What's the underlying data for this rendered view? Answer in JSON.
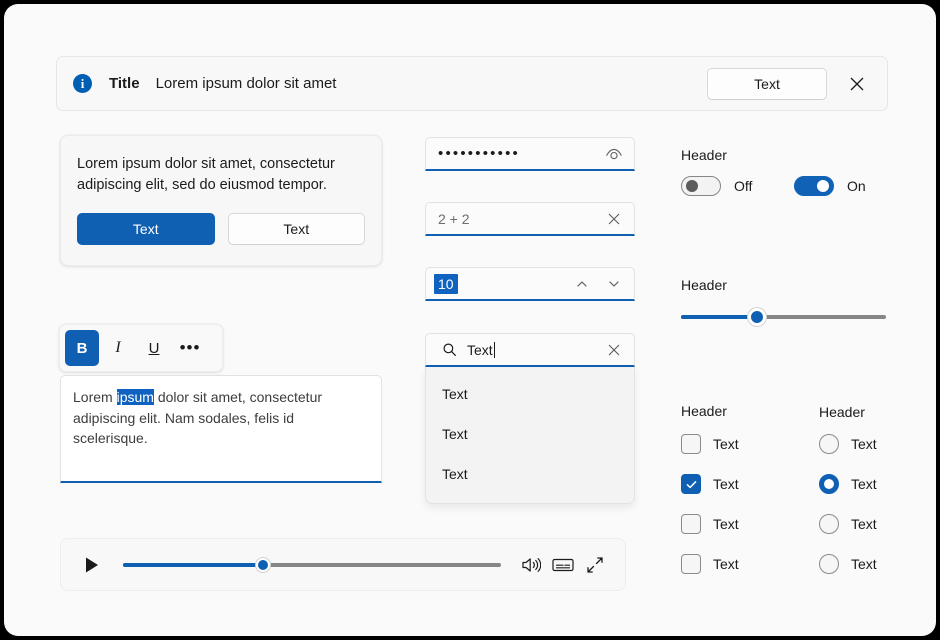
{
  "infobar": {
    "icon": "info-icon",
    "title": "Title",
    "message": "Lorem ipsum dolor sit amet",
    "action_label": "Text",
    "close_icon": "close-icon"
  },
  "dialog": {
    "body": "Lorem ipsum dolor sit amet, consectetur adipiscing elit, sed do eiusmod tempor.",
    "primary_label": "Text",
    "secondary_label": "Text"
  },
  "editor": {
    "toolbar": [
      {
        "name": "bold",
        "glyph": "B",
        "active": true
      },
      {
        "name": "italic",
        "glyph": "I",
        "active": false
      },
      {
        "name": "underline",
        "glyph": "U",
        "active": false
      },
      {
        "name": "more",
        "glyph": "•••",
        "active": false
      }
    ],
    "text_before": "Lorem ",
    "text_selected": "ipsum",
    "text_after": " dolor sit amet, consectetur adipiscing elit. Nam sodales, felis id scelerisque."
  },
  "media": {
    "play_icon": "play-icon",
    "progress_percent": 37,
    "volume_icon": "volume-icon",
    "captions_icon": "captions-icon",
    "fullscreen_icon": "fullscreen-icon"
  },
  "fields": {
    "password": {
      "value": "•••••••••••",
      "reveal_icon": "eye-icon"
    },
    "expression": {
      "placeholder": "2 + 2",
      "value": "",
      "clear_icon": "close-icon"
    },
    "number": {
      "value": "10",
      "up_icon": "chevron-up-icon",
      "down_icon": "chevron-down-icon"
    }
  },
  "search": {
    "icon": "search-icon",
    "value": "Text",
    "clear_icon": "close-icon",
    "options": [
      "Text",
      "Text",
      "Text"
    ]
  },
  "toggles": {
    "header": "Header",
    "items": [
      {
        "label": "Off",
        "on": false
      },
      {
        "label": "On",
        "on": true
      }
    ]
  },
  "slider": {
    "header": "Header",
    "value_percent": 37
  },
  "checkboxes": {
    "header": "Header",
    "items": [
      {
        "label": "Text",
        "checked": false
      },
      {
        "label": "Text",
        "checked": true
      },
      {
        "label": "Text",
        "checked": false
      },
      {
        "label": "Text",
        "checked": false
      }
    ]
  },
  "radios": {
    "header": "Header",
    "items": [
      {
        "label": "Text",
        "selected": false
      },
      {
        "label": "Text",
        "selected": true
      },
      {
        "label": "Text",
        "selected": false
      },
      {
        "label": "Text",
        "selected": false
      }
    ]
  },
  "colors": {
    "accent": "#0f5fb3",
    "accent_toggle": "#0f62b5",
    "selection": "#0f62c0",
    "page_bg": "#fafafa",
    "track": "#868686"
  }
}
